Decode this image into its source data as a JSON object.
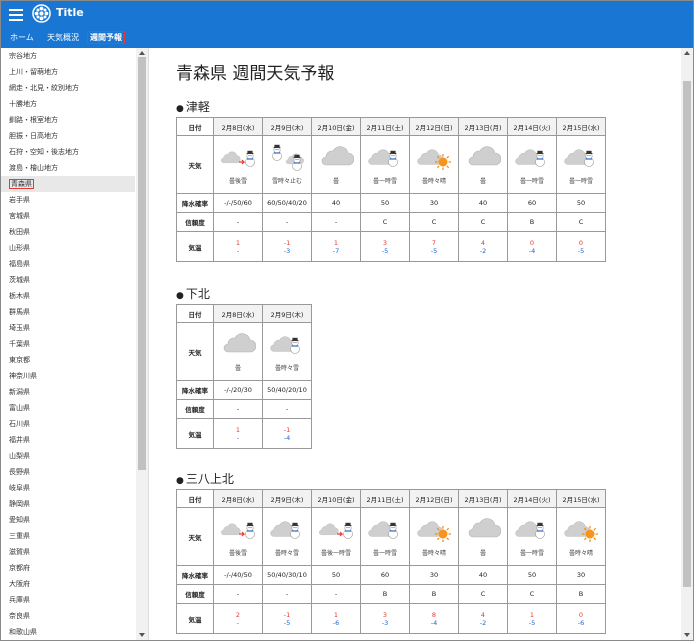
{
  "app": {
    "title": "Title"
  },
  "nav": {
    "tabs": [
      {
        "label": "ホーム"
      },
      {
        "label": "天気概況"
      },
      {
        "label": "週間予報"
      }
    ]
  },
  "sidebar": {
    "items": [
      "宗谷地方",
      "上川・留萌地方",
      "網走・北見・紋別地方",
      "十勝地方",
      "釧路・根室地方",
      "胆振・日高地方",
      "石狩・空知・後志地方",
      "渡島・檜山地方",
      "青森県",
      "岩手県",
      "宮城県",
      "秋田県",
      "山形県",
      "福島県",
      "茨城県",
      "栃木県",
      "群馬県",
      "埼玉県",
      "千葉県",
      "東京都",
      "神奈川県",
      "新潟県",
      "富山県",
      "石川県",
      "福井県",
      "山梨県",
      "長野県",
      "岐阜県",
      "静岡県",
      "愛知県",
      "三重県",
      "滋賀県",
      "京都府",
      "大阪府",
      "兵庫県",
      "奈良県",
      "和歌山県"
    ],
    "selected": "青森県"
  },
  "page": {
    "title": "青森県 週間天気予報"
  },
  "labels": {
    "date": "日付",
    "weather": "天気",
    "rain": "降水確率",
    "reliability": "信頼度",
    "temp": "気温"
  },
  "regions": [
    {
      "name": "津軽",
      "days": [
        {
          "date": "2月8日(水)",
          "icon": "cloudy-then-snow",
          "wx": "曇後雪",
          "rain": "-/-/50/60",
          "rel": "-",
          "max": "1",
          "min": "-"
        },
        {
          "date": "2月9日(木)",
          "icon": "snow-occasionally-cloudy",
          "wx": "雪時々止む",
          "rain": "60/50/40/20",
          "rel": "-",
          "max": "-1",
          "min": "-3"
        },
        {
          "date": "2月10日(金)",
          "icon": "cloudy",
          "wx": "曇",
          "rain": "40",
          "rel": "-",
          "max": "1",
          "min": "-7"
        },
        {
          "date": "2月11日(土)",
          "icon": "cloudy-snow",
          "wx": "曇一時雪",
          "rain": "50",
          "rel": "C",
          "max": "3",
          "min": "-5"
        },
        {
          "date": "2月12日(日)",
          "icon": "cloudy-sunny",
          "wx": "曇時々晴",
          "rain": "30",
          "rel": "C",
          "max": "7",
          "min": "-5"
        },
        {
          "date": "2月13日(月)",
          "icon": "cloudy",
          "wx": "曇",
          "rain": "40",
          "rel": "C",
          "max": "4",
          "min": "-2"
        },
        {
          "date": "2月14日(火)",
          "icon": "cloudy-snow",
          "wx": "曇一時雪",
          "rain": "60",
          "rel": "B",
          "max": "0",
          "min": "-4"
        },
        {
          "date": "2月15日(水)",
          "icon": "cloudy-snow",
          "wx": "曇一時雪",
          "rain": "50",
          "rel": "C",
          "max": "0",
          "min": "-5"
        }
      ]
    },
    {
      "name": "下北",
      "days": [
        {
          "date": "2月8日(水)",
          "icon": "cloudy",
          "wx": "曇",
          "rain": "-/-/20/30",
          "rel": "-",
          "max": "1",
          "min": "-"
        },
        {
          "date": "2月9日(木)",
          "icon": "cloudy-snow",
          "wx": "曇時々雪",
          "rain": "50/40/20/10",
          "rel": "-",
          "max": "-1",
          "min": "-4"
        }
      ]
    },
    {
      "name": "三八上北",
      "days": [
        {
          "date": "2月8日(水)",
          "icon": "cloudy-then-snow",
          "wx": "曇後雪",
          "rain": "-/-/40/50",
          "rel": "-",
          "max": "2",
          "min": "-"
        },
        {
          "date": "2月9日(木)",
          "icon": "cloudy-snow",
          "wx": "曇時々雪",
          "rain": "50/40/30/10",
          "rel": "-",
          "max": "-1",
          "min": "-5"
        },
        {
          "date": "2月10日(金)",
          "icon": "cloudy-then-snow",
          "wx": "曇後一時雪",
          "rain": "50",
          "rel": "-",
          "max": "1",
          "min": "-6"
        },
        {
          "date": "2月11日(土)",
          "icon": "cloudy-snow",
          "wx": "曇一時雪",
          "rain": "60",
          "rel": "B",
          "max": "3",
          "min": "-3"
        },
        {
          "date": "2月12日(日)",
          "icon": "cloudy-sunny",
          "wx": "曇時々晴",
          "rain": "30",
          "rel": "B",
          "max": "8",
          "min": "-4"
        },
        {
          "date": "2月13日(月)",
          "icon": "cloudy",
          "wx": "曇",
          "rain": "40",
          "rel": "C",
          "max": "4",
          "min": "-2"
        },
        {
          "date": "2月14日(火)",
          "icon": "cloudy-snow",
          "wx": "曇一時雪",
          "rain": "50",
          "rel": "C",
          "max": "1",
          "min": "-5"
        },
        {
          "date": "2月15日(水)",
          "icon": "cloudy-sunny",
          "wx": "曇時々晴",
          "rain": "30",
          "rel": "B",
          "max": "0",
          "min": "-6"
        }
      ]
    }
  ]
}
